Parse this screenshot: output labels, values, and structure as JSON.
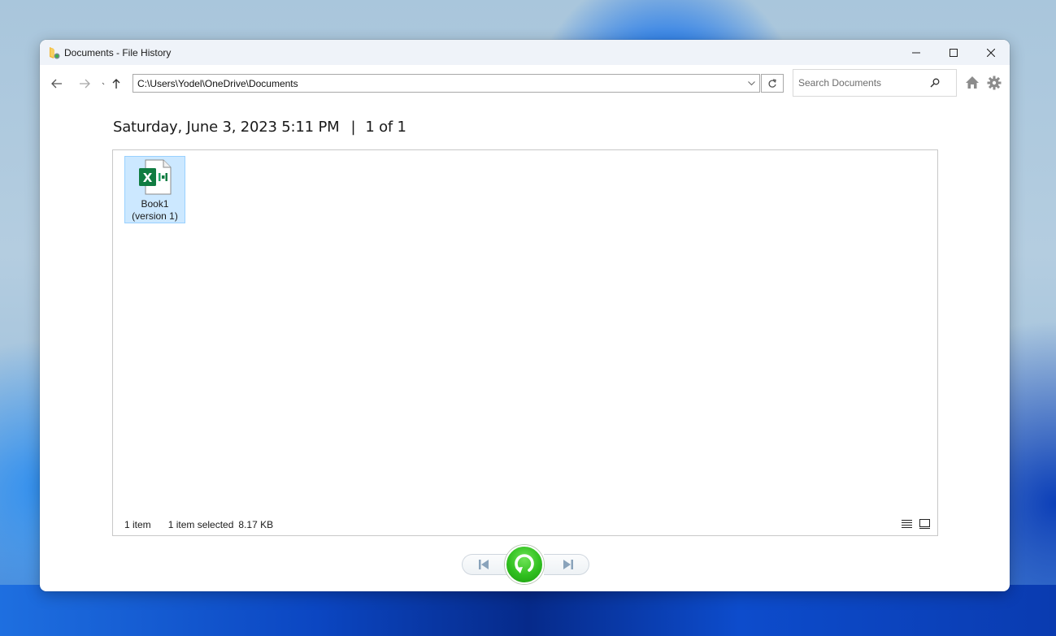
{
  "window": {
    "title": "Documents - File History",
    "controls": {
      "minimize": "minimize",
      "maximize": "maximize",
      "close": "close"
    }
  },
  "toolbar": {
    "address_path": "C:\\Users\\Yodel\\OneDrive\\Documents",
    "search_placeholder": "Search Documents",
    "search_value": ""
  },
  "header": {
    "date": "Saturday, June 3, 2023 5:11 PM",
    "separator": "|",
    "position": "1 of 1"
  },
  "files": [
    {
      "name": "Book1",
      "version": "(version 1)",
      "type": "excel-workbook",
      "selected": true
    }
  ],
  "status": {
    "item_count": "1 item",
    "selected": "1 item selected",
    "size": "8.17 KB"
  },
  "colors": {
    "restore_green": "#2fbf1e",
    "selection_bg": "#cce8ff",
    "excel_green": "#107c41"
  }
}
